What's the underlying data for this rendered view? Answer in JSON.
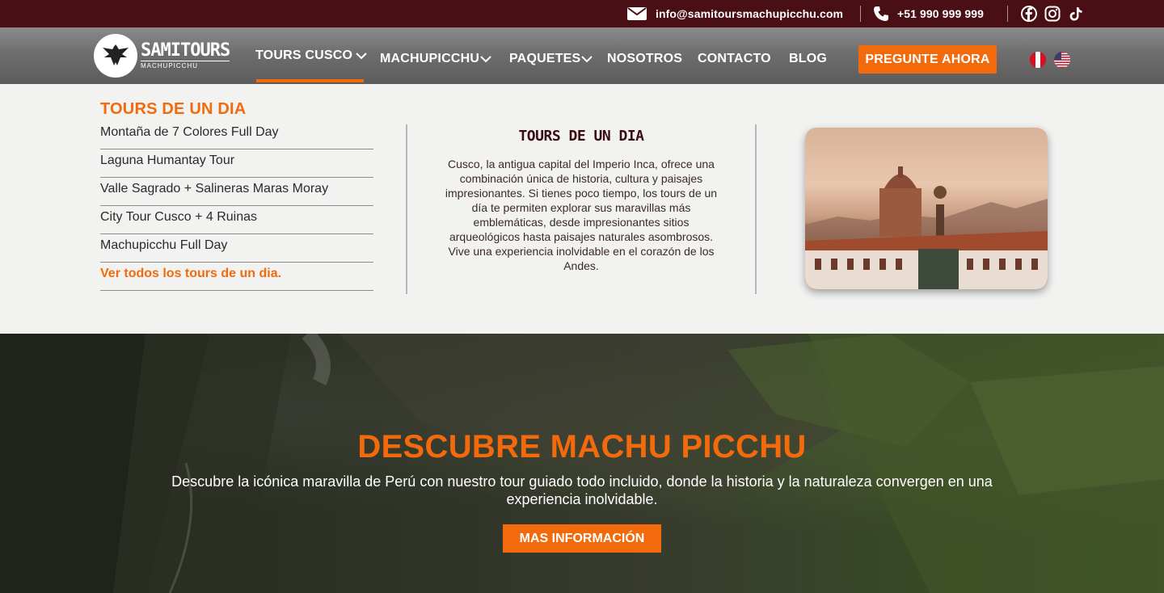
{
  "topbar": {
    "email": "info@samitoursmachupicchu.com",
    "phone": "+51 990 999 999",
    "social": [
      "facebook-icon",
      "instagram-icon",
      "tiktok-icon"
    ]
  },
  "logo": {
    "main": "SAMITOURS",
    "sub": "MACHUPICCHU"
  },
  "nav": {
    "items": [
      {
        "label": "TOURS CUSCO",
        "has_dropdown": true,
        "active": true
      },
      {
        "label": "MACHUPICCHU",
        "has_dropdown": true
      },
      {
        "label": "PAQUETES",
        "has_dropdown": true
      },
      {
        "label": "NOSOTROS"
      },
      {
        "label": "CONTACTO"
      },
      {
        "label": "BLOG"
      }
    ],
    "cta_label": "PREGUNTE AHORA",
    "languages": [
      "peru-flag-icon",
      "usa-flag-icon"
    ]
  },
  "dropdown": {
    "heading": "TOURS DE UN DIA",
    "items": [
      "Montaña de 7 Colores Full Day",
      "Laguna Humantay Tour",
      "Valle Sagrado + Salineras Maras Moray",
      "City Tour Cusco + 4 Ruinas",
      "Machupicchu Full Day",
      "Ver todos los tours de un dia."
    ],
    "center_title": "TOURS DE UN DIA",
    "center_text": "Cusco, la antigua capital del Imperio Inca, ofrece una combinación única de historia, cultura y paisajes impresionantes. Si tienes poco tiempo, los tours de un día te permiten explorar sus maravillas más emblemáticas, desde impresionantes sitios arqueológicos hasta paisajes naturales asombrosos. Vive una experiencia inolvidable en el corazón de los Andes."
  },
  "hero": {
    "title": "DESCUBRE MACHU PICCHU",
    "subtitle": "Descubre la icónica maravilla de Perú con nuestro tour guiado todo incluido, donde la historia y la naturaleza convergen en una experiencia inolvidable.",
    "button_label": "MAS INFORMACIÓN"
  },
  "colors": {
    "topbar_bg": "#4a0f14",
    "accent": "#f26a0c",
    "nav_bg": "#6e6e6e"
  }
}
